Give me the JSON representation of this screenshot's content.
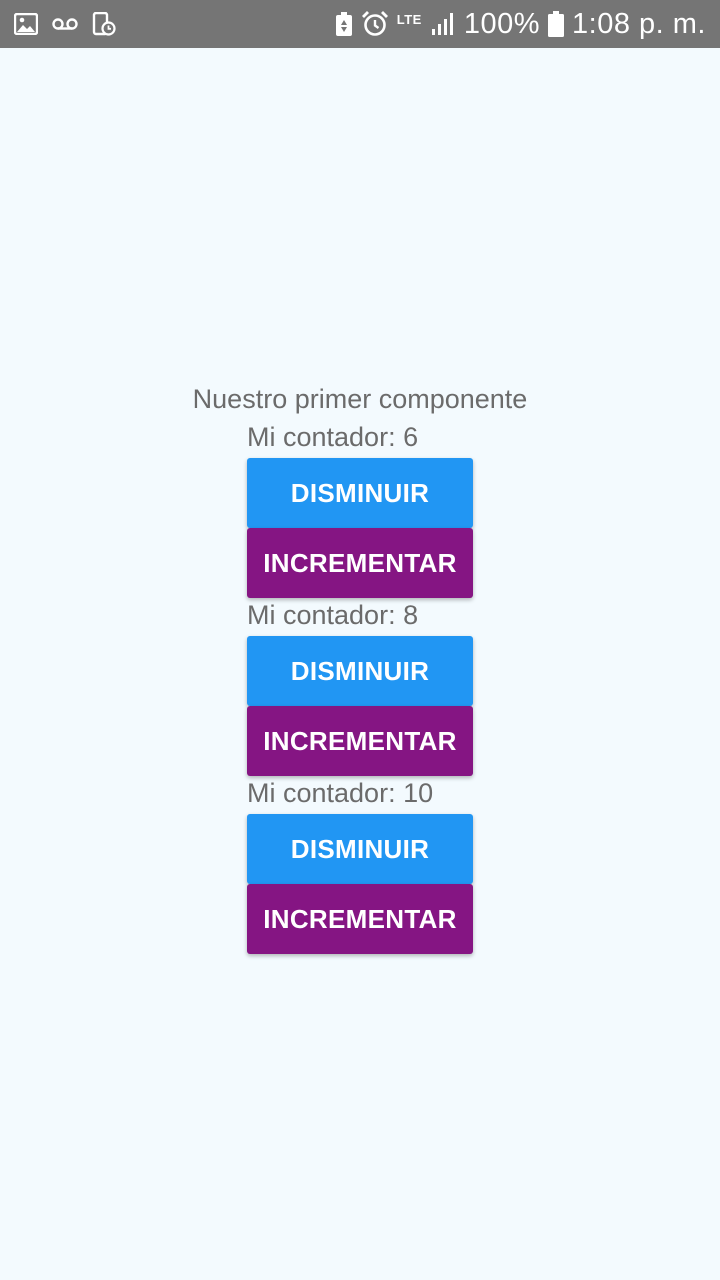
{
  "status_bar": {
    "battery_percent": "100%",
    "time": "1:08 p. m.",
    "network_type": "LTE",
    "icons": [
      "image-icon",
      "voicemail-icon",
      "phone-clock-icon",
      "battery-saver-icon",
      "alarm-icon",
      "signal-icon",
      "battery-icon"
    ]
  },
  "main": {
    "heading": "Nuestro primer componente",
    "counters": [
      {
        "label": "Mi contador: 6",
        "decrement_label": "DISMINUIR",
        "increment_label": "INCREMENTAR"
      },
      {
        "label": "Mi contador: 8",
        "decrement_label": "DISMINUIR",
        "increment_label": "INCREMENTAR"
      },
      {
        "label": "Mi contador: 10",
        "decrement_label": "DISMINUIR",
        "increment_label": "INCREMENTAR"
      }
    ]
  },
  "colors": {
    "background": "#f3fafe",
    "status_bar": "#757575",
    "decrement_button": "#2196f3",
    "increment_button": "#851583",
    "text": "#6b6b6b"
  }
}
